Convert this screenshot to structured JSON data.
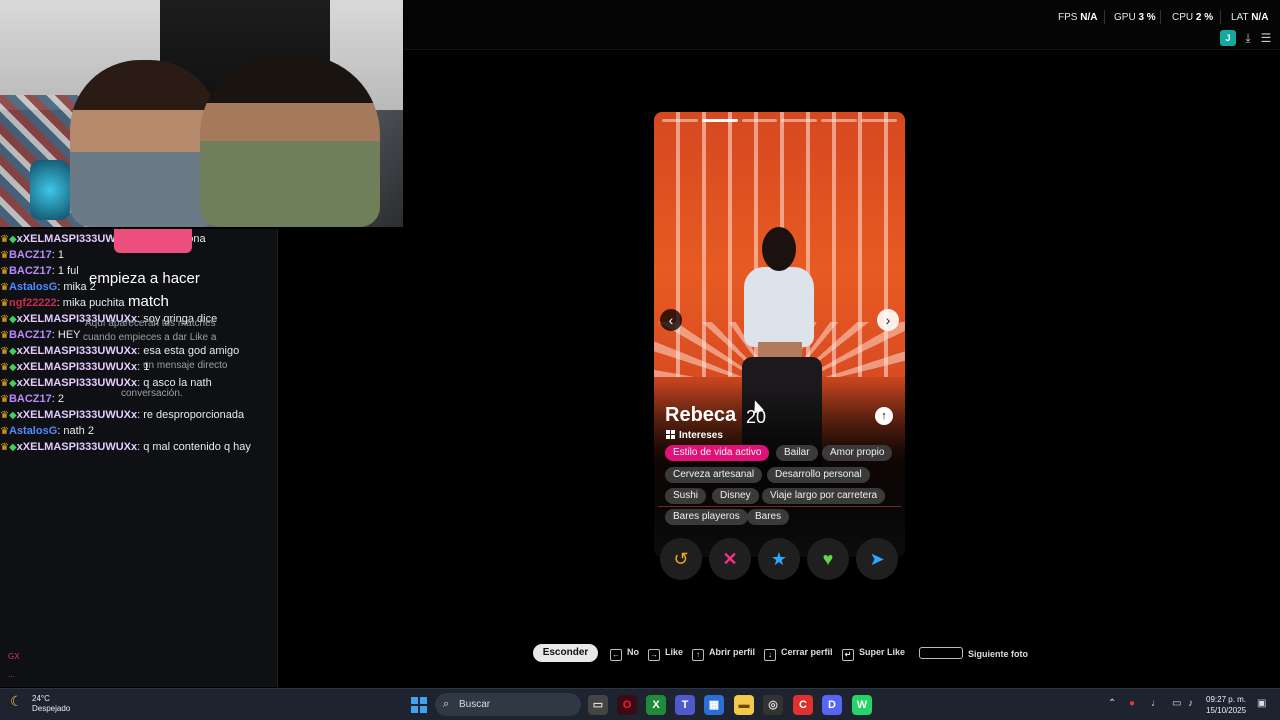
{
  "stats": {
    "fps_label": "FPS",
    "fps_value": "N/A",
    "gpu_label": "GPU",
    "gpu_value": "3 %",
    "cpu_label": "CPU",
    "cpu_value": "2 %",
    "lat_label": "LAT",
    "lat_value": "N/A"
  },
  "header": {
    "avatar_letter": "J"
  },
  "chat": {
    "messages": [
      {
        "user": "xXELMASPI333UWUXx",
        "text": ": mika bezona",
        "color": "#e6c9ff"
      },
      {
        "user": "BACZ17",
        "text": ": 1",
        "color": "#b98cff"
      },
      {
        "user": "BACZ17",
        "text": ": 1 ful",
        "color": "#b98cff"
      },
      {
        "user": "AstalosG",
        "text": ": mika 2",
        "color": "#4f8cff"
      },
      {
        "user": "ngf22222",
        "text": ": mika puchita",
        "color": "#d0294e"
      },
      {
        "user": "xXELMASPI333UWUXx",
        "text": ": soy gringa dice",
        "color": "#e6c9ff"
      },
      {
        "user": "BACZ17",
        "text": ": HEY",
        "color": "#b98cff"
      },
      {
        "user": "xXELMASPI333UWUXx",
        "text": ": esa esta god amigo",
        "color": "#e6c9ff"
      },
      {
        "user": "xXELMASPI333UWUXx",
        "text": ": 1",
        "color": "#e6c9ff"
      },
      {
        "user": "xXELMASPI333UWUXx",
        "text": ": q asco la nath",
        "color": "#e6c9ff"
      },
      {
        "user": "BACZ17",
        "text": ": 2",
        "color": "#b98cff"
      },
      {
        "user": "xXELMASPI333UWUXx",
        "text": ": re desproporcionada",
        "color": "#e6c9ff"
      },
      {
        "user": "AstalosG",
        "text": ": nath 2",
        "color": "#4f8cff"
      },
      {
        "user": "xXELMASPI333UWUXx",
        "text": ": q mal contenido q hay",
        "color": "#e6c9ff"
      }
    ],
    "overlay_title_1": "empieza a hacer",
    "overlay_title_2": "match",
    "overlay_lines": [
      "Aquí aparecerán tus matches",
      "cuando empieces a dar Like a",
      "un mensaje directo",
      "conversación."
    ],
    "footer_1": "GX",
    "footer_2": "..."
  },
  "profile": {
    "name": "Rebeca",
    "age": "20",
    "interests_label": "Intereses",
    "interests": [
      {
        "label": "Estilo de vida activo",
        "active": true
      },
      {
        "label": "Bailar",
        "active": false
      },
      {
        "label": "Amor propio",
        "active": false
      },
      {
        "label": "Cerveza artesanal",
        "active": false
      },
      {
        "label": "Desarrollo personal",
        "active": false
      },
      {
        "label": "Sushi",
        "active": false
      },
      {
        "label": "Disney",
        "active": false
      },
      {
        "label": "Viaje largo por carretera",
        "active": false
      },
      {
        "label": "Bares playeros",
        "active": false
      },
      {
        "label": "Bares",
        "active": false
      }
    ],
    "photo_count": 6,
    "photo_index": 1
  },
  "actions": {
    "rewind": "↺",
    "nope": "✕",
    "superlike": "★",
    "like": "♥",
    "boost": "➤"
  },
  "shortcuts": {
    "hide": "Esconder",
    "no": "No",
    "like": "Like",
    "open": "Abrir perfil",
    "close": "Cerrar perfil",
    "superlike": "Super Like",
    "next_photo": "Siguiente foto"
  },
  "taskbar": {
    "temp": "24°C",
    "weather": "Despejado",
    "search": "Buscar",
    "time": "09:27 p. m.",
    "date": "15/10/2025"
  }
}
